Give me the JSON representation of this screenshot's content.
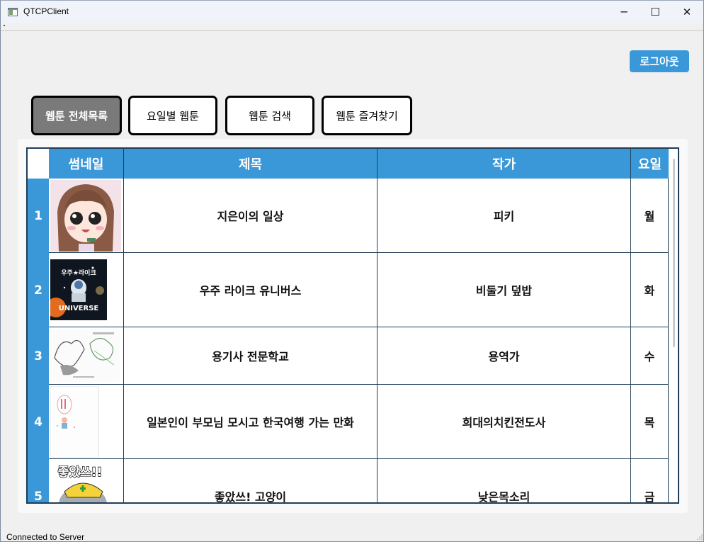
{
  "window": {
    "title": "QTCPClient",
    "minimize_glyph": "─",
    "maximize_glyph": "☐",
    "close_glyph": "✕"
  },
  "header": {
    "logout_label": "로그아웃"
  },
  "tabs": [
    {
      "label": "웹툰 전체목록",
      "active": true
    },
    {
      "label": "요일별 웹툰",
      "active": false
    },
    {
      "label": "웹툰 검색",
      "active": false
    },
    {
      "label": "웹툰 즐겨찾기",
      "active": false
    }
  ],
  "table": {
    "headers": {
      "thumbnail": "썸네일",
      "title": "제목",
      "author": "작가",
      "day": "요일"
    },
    "rows": [
      {
        "num": "1",
        "title": "지은이의 일상",
        "author": "피키",
        "day": "월",
        "thumb": "girl-face-thumbnail"
      },
      {
        "num": "2",
        "title": "우주 라이크 유니버스",
        "author": "비둘기 덮밥",
        "day": "화",
        "thumb": "astronaut-thumbnail",
        "thumb_text": "우주★라이크",
        "thumb_text2": "UNIVERSE"
      },
      {
        "num": "3",
        "title": "용기사 전문학교",
        "author": "용역가",
        "day": "수",
        "thumb": "dragon-sketch-thumbnail"
      },
      {
        "num": "4",
        "title": "일본인이 부모님 모시고 한국여행 가는 만화",
        "author": "희대의치킨전도사",
        "day": "목",
        "thumb": "book-cover-thumbnail"
      },
      {
        "num": "5",
        "title": "좋았쓰! 고양이",
        "author": "낮은목소리",
        "day": "금",
        "thumb": "cat-thumbnail",
        "thumb_text": "좋았쓰!!"
      }
    ]
  },
  "status": {
    "text": "Connected to Server"
  },
  "colors": {
    "accent": "#3a98d8",
    "active_tab": "#7a7a7a",
    "grid": "#1f3d57"
  }
}
